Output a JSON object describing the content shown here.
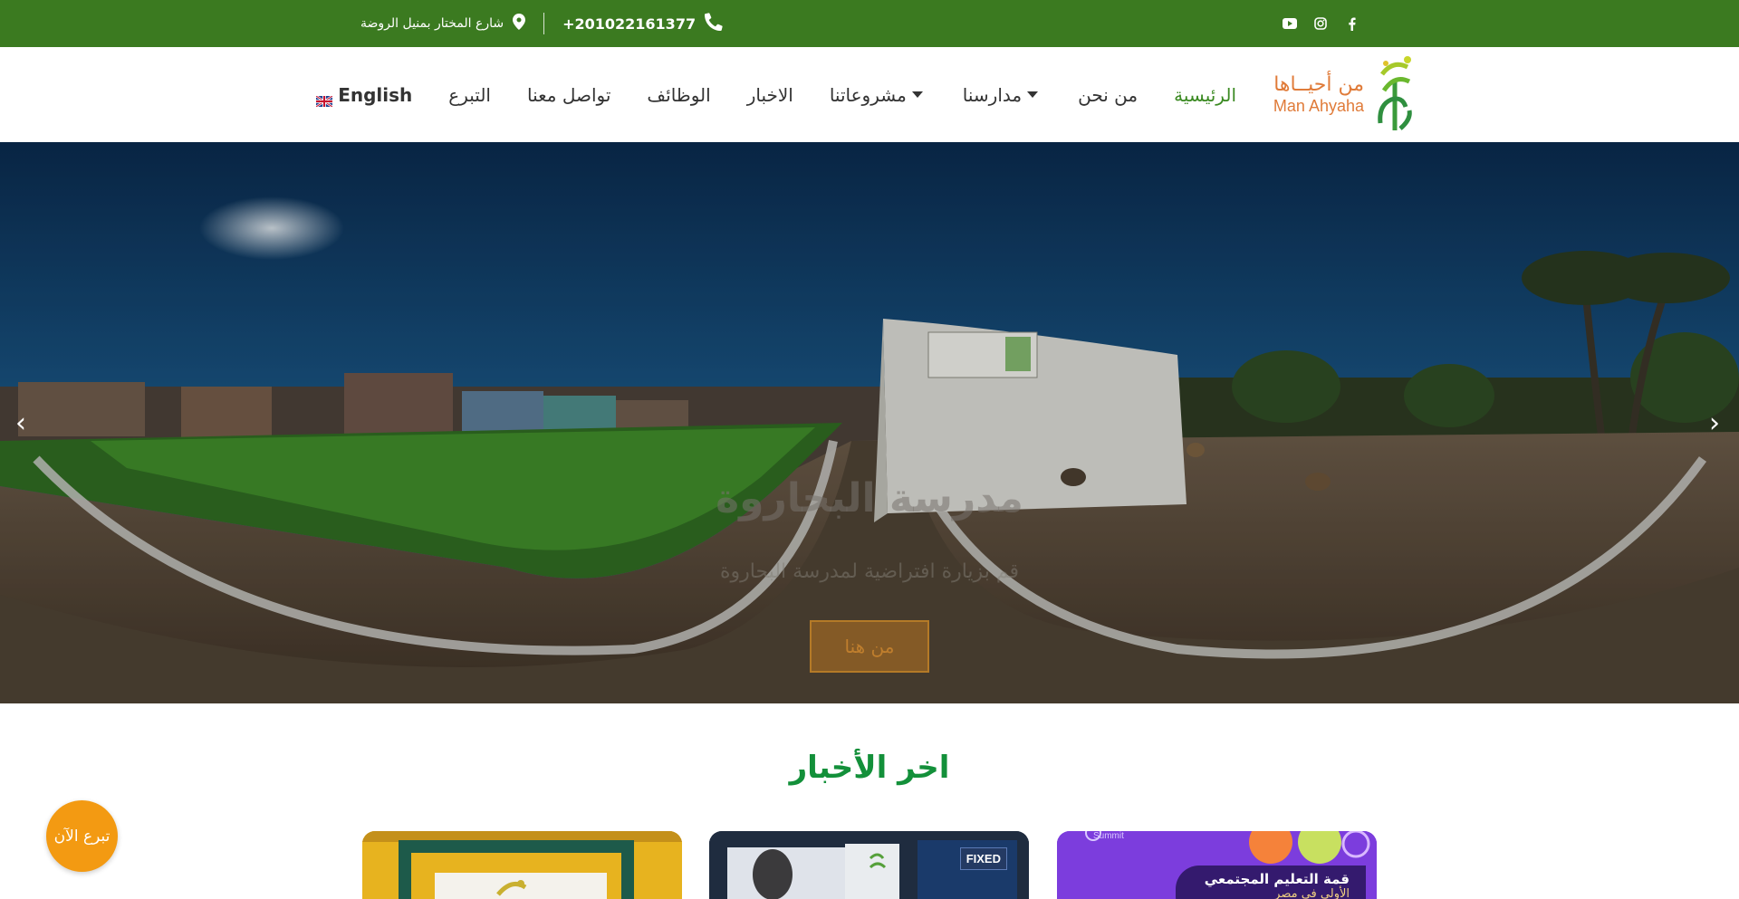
{
  "topbar": {
    "address": "شارع المختار بمنيل الروضة",
    "phone": "+201022161377",
    "social": [
      "facebook-icon",
      "instagram-icon",
      "youtube-icon"
    ],
    "background": "#3b7a20"
  },
  "logo": {
    "name_ar": "من أحيــاها",
    "name_en": "Man Ahyaha"
  },
  "nav": {
    "items": [
      {
        "label": "الرئيسية",
        "active": true
      },
      {
        "label": "من نحن"
      },
      {
        "label": "مدارسنا",
        "dropdown": true
      },
      {
        "label": "مشروعاتنا",
        "dropdown": true
      },
      {
        "label": "الاخبار"
      },
      {
        "label": "الوظائف"
      },
      {
        "label": "تواصل معنا"
      },
      {
        "label": "التبرع"
      },
      {
        "label": "English"
      }
    ],
    "accent": "#3b8a22"
  },
  "hero": {
    "title": "مدرسة البحاروة",
    "subtitle": "قم بزيارة افتراضية لمدرسة البحاروة",
    "button": "من هنا",
    "prev": "‹",
    "next": "›"
  },
  "news": {
    "title": "اخر الأخبار",
    "title_color": "#13903a",
    "cards": [
      {
        "type": "stage-photo"
      },
      {
        "type": "event-photo",
        "badge": "FIXED"
      },
      {
        "type": "poster",
        "header": "Summit",
        "line1": "قمة التعليم المجتمعي",
        "line2": "الأولى في مصر"
      }
    ]
  },
  "donate_button": "تبرع الآن"
}
